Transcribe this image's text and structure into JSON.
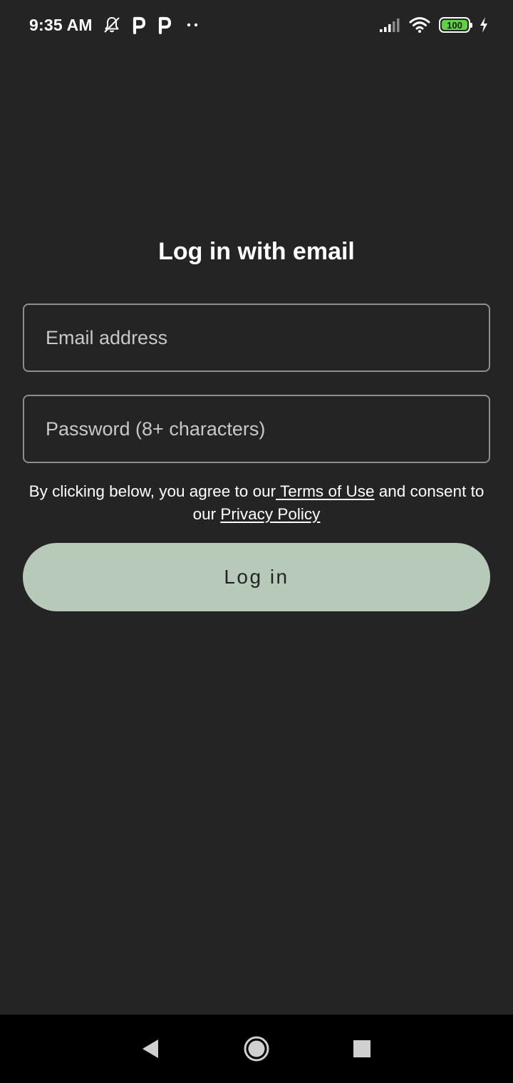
{
  "status_bar": {
    "time": "9:35 AM",
    "battery_level": "100",
    "icons": [
      "notifications-off-icon",
      "p-app-icon",
      "p-app-icon",
      "more-dots-icon",
      "signal-icon",
      "wifi-icon",
      "battery-icon",
      "charging-icon"
    ],
    "battery_color": "#5dd341"
  },
  "login": {
    "title": "Log in with email",
    "email_placeholder": "Email address",
    "email_value": "",
    "password_placeholder": "Password (8+ characters)",
    "password_value": "",
    "consent_prefix": "By clicking below, you agree to our",
    "terms_link": " Terms of Use",
    "consent_middle": " and consent to our ",
    "privacy_link": "Privacy Policy",
    "button_label": "Log in",
    "button_color": "#b7c9b8"
  },
  "nav_bar": {
    "icons": [
      "back-icon",
      "home-icon",
      "recents-icon"
    ]
  },
  "colors": {
    "background": "#242424",
    "field_border": "#8e8e8e"
  }
}
